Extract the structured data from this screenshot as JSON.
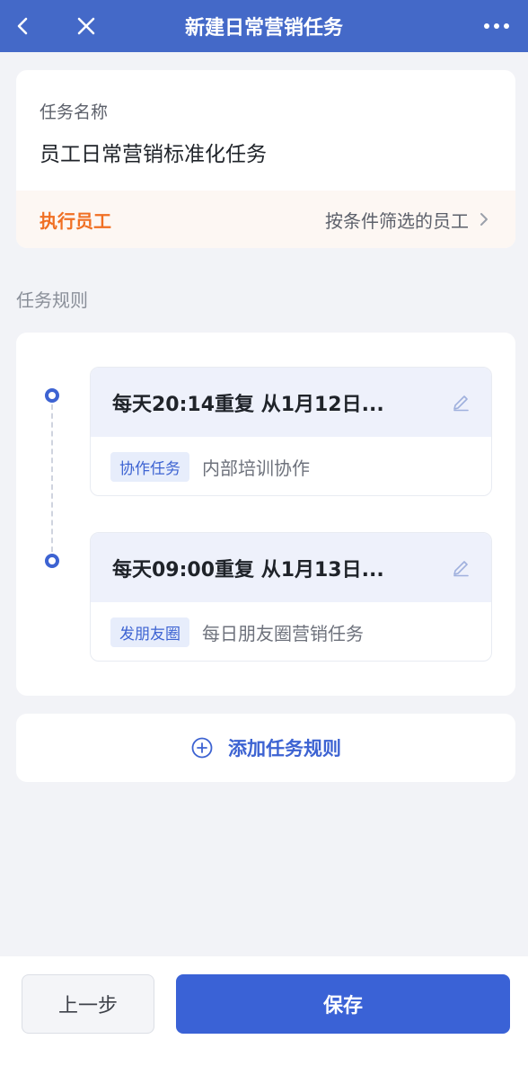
{
  "colors": {
    "navbar": "#4469c8",
    "accent": "#3d63d2",
    "executor_label": "#f06f23",
    "save_button": "#3a62d6",
    "background": "#f2f3f7"
  },
  "navbar": {
    "title": "新建日常营销任务",
    "back_icon": "chevron-left-icon",
    "close_icon": "close-icon",
    "more_icon": "more-dots-icon"
  },
  "task_info": {
    "name_label": "任务名称",
    "name_value": "员工日常营销标准化任务",
    "executor_label": "执行员工",
    "executor_value": "按条件筛选的员工",
    "executor_icon": "chevron-right-icon"
  },
  "rules_section": {
    "title": "任务规则",
    "rules": [
      {
        "title": "每天20:14重复 从1月12日...",
        "tag": "协作任务",
        "description": "内部培训协作",
        "edit_icon": "pencil-icon"
      },
      {
        "title": "每天09:00重复 从1月13日...",
        "tag": "发朋友圈",
        "description": "每日朋友圈营销任务",
        "edit_icon": "pencil-icon"
      }
    ],
    "add_label": "添加任务规则",
    "add_icon": "plus-circle-icon"
  },
  "footer": {
    "prev_label": "上一步",
    "save_label": "保存"
  }
}
